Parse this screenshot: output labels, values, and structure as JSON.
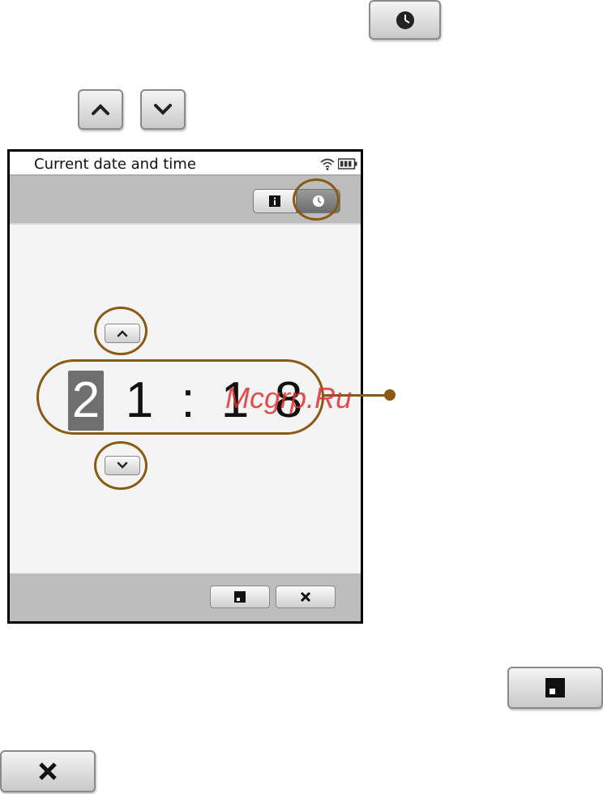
{
  "status_bar": {
    "title": "Current date and time",
    "icons": [
      "wifi-icon",
      "battery-icon"
    ]
  },
  "toolbar": {
    "buttons": [
      "info-icon",
      "clock-icon"
    ]
  },
  "time_editor": {
    "digits": [
      "2",
      "1",
      ":",
      "1",
      "8"
    ],
    "selected_index": 0
  },
  "bottom_bar": {
    "buttons": [
      "save-icon",
      "close-icon"
    ]
  },
  "watermark": {
    "text": "Mcgrp.Ru"
  },
  "colors": {
    "annotation": "#8a5a14",
    "selected_digit": "#6f6f6f",
    "watermark": "#e03030"
  }
}
